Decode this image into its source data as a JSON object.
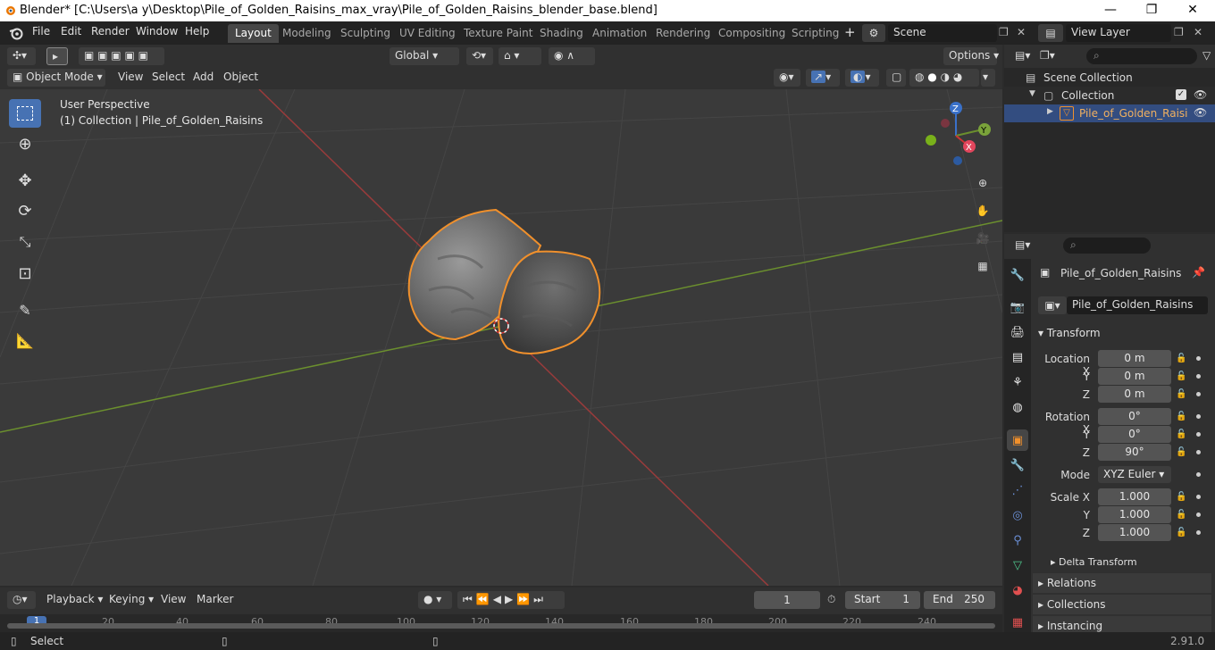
{
  "window": {
    "title": "Blender* [C:\\Users\\a y\\Desktop\\Pile_of_Golden_Raisins_max_vray\\Pile_of_Golden_Raisins_blender_base.blend]",
    "min": "—",
    "max": "❐",
    "close": "✕"
  },
  "menu": [
    "File",
    "Edit",
    "Render",
    "Window",
    "Help"
  ],
  "workspaces": [
    "Layout",
    "Modeling",
    "Sculpting",
    "UV Editing",
    "Texture Paint",
    "Shading",
    "Animation",
    "Rendering",
    "Compositing",
    "Scripting"
  ],
  "scene": {
    "name": "Scene",
    "view_layer": "View Layer"
  },
  "viewport_header": {
    "transform": "Global",
    "options": "Options",
    "mode": "Object Mode",
    "menus": [
      "View",
      "Select",
      "Add",
      "Object"
    ]
  },
  "overlay": {
    "perspective": "User Perspective",
    "collection": "(1) Collection | Pile_of_Golden_Raisins"
  },
  "gizmo": {
    "x": "X",
    "y": "Y",
    "z": "Z"
  },
  "outliner": {
    "root": "Scene Collection",
    "collection": "Collection",
    "object": "Pile_of_Golden_Raisi"
  },
  "properties": {
    "object_name": "Pile_of_Golden_Raisins",
    "data_name": "Pile_of_Golden_Raisins",
    "transform_title": "Transform",
    "location_label": "Location X",
    "rotation_label": "Rotation X",
    "scale_label": "Scale X",
    "y_label": "Y",
    "z_label": "Z",
    "location": [
      "0 m",
      "0 m",
      "0 m"
    ],
    "rotation": [
      "0°",
      "0°",
      "90°"
    ],
    "mode_label": "Mode",
    "mode": "XYZ Euler",
    "scale": [
      "1.000",
      "1.000",
      "1.000"
    ],
    "delta": "Delta Transform",
    "sections": [
      "Relations",
      "Collections",
      "Instancing"
    ]
  },
  "timeline": {
    "menus": [
      "Playback",
      "Keying",
      "View",
      "Marker"
    ],
    "current_frame": "1",
    "start_label": "Start",
    "start": "1",
    "end_label": "End",
    "end": "250",
    "ticks": [
      "1",
      "20",
      "40",
      "60",
      "80",
      "100",
      "120",
      "140",
      "160",
      "180",
      "200",
      "220",
      "240"
    ]
  },
  "status": {
    "left": "Select",
    "version": "2.91.0"
  },
  "colors": {
    "accent": "#4772b3",
    "selection": "#f0902c",
    "x_axis": "#a03838",
    "y_axis": "#6b8f2e"
  }
}
